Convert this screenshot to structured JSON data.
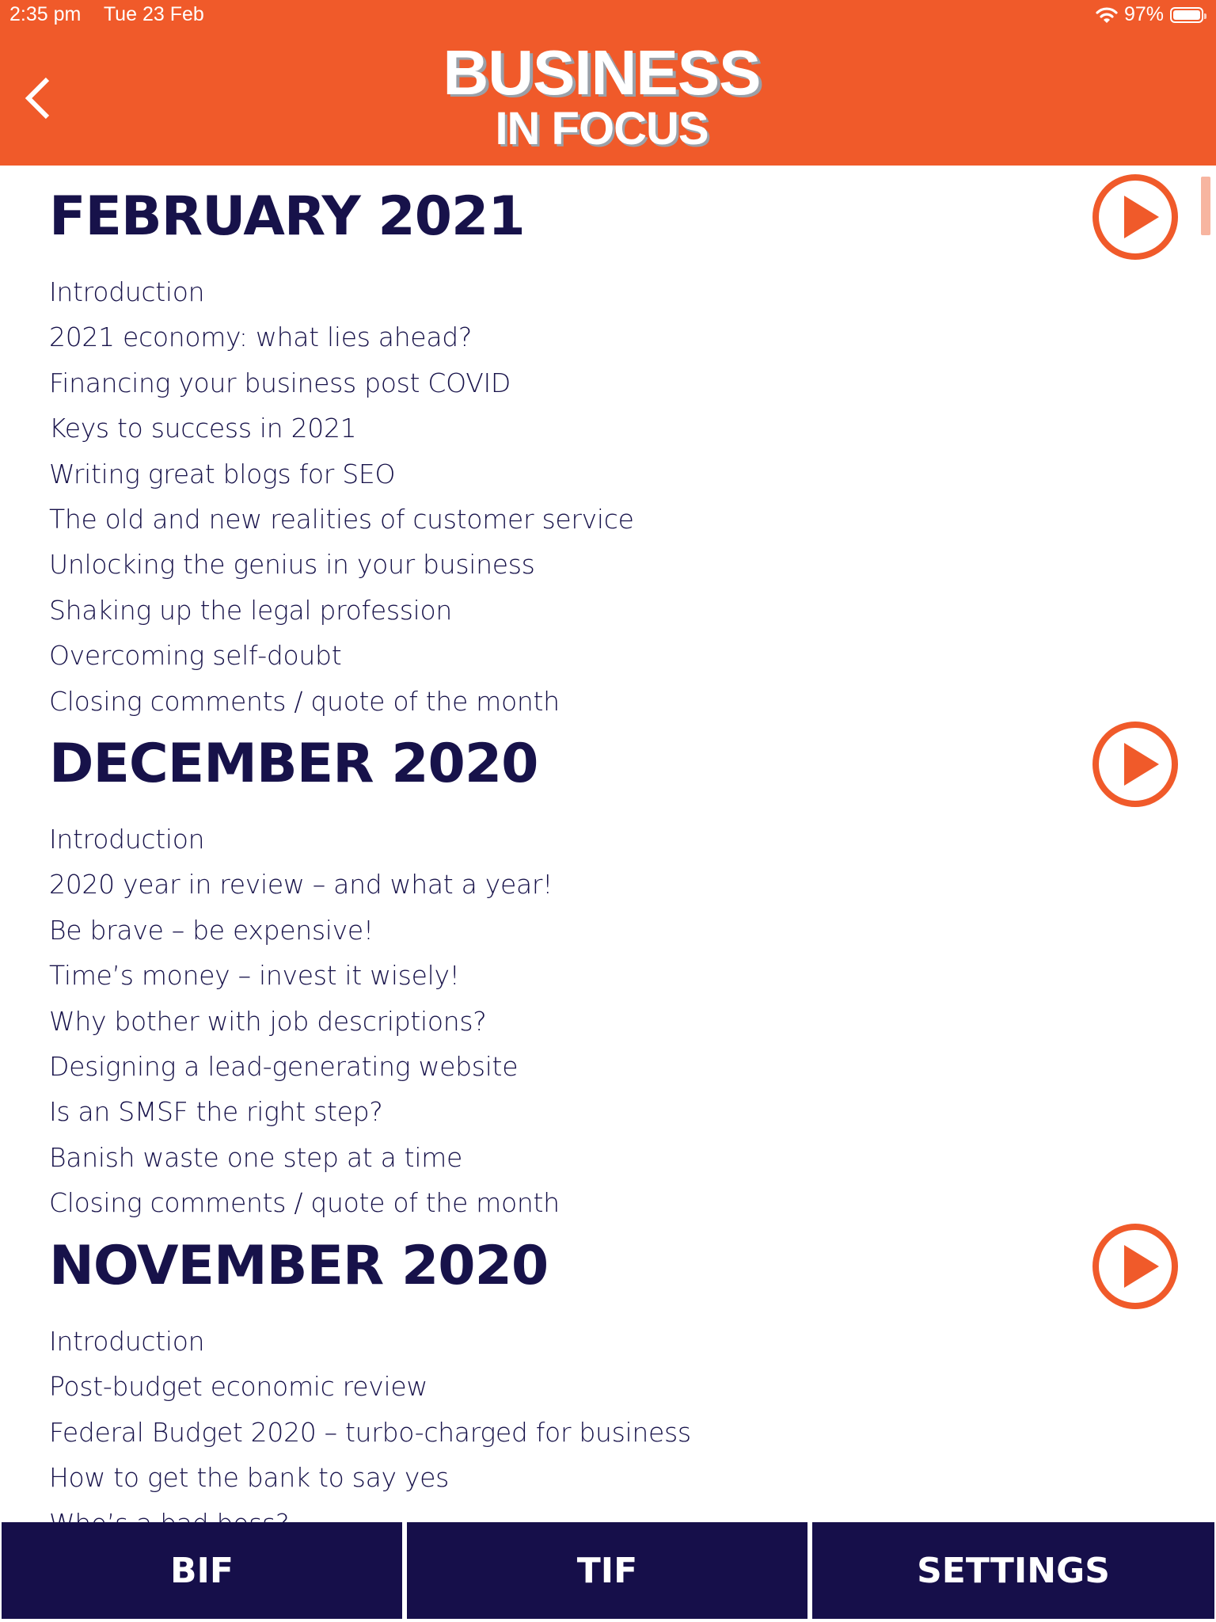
{
  "status_bar": {
    "time": "2:35 pm",
    "date": "Tue 23 Feb",
    "battery_percent": "97%"
  },
  "header": {
    "logo_line1": "BUSINESS",
    "logo_line2": "IN FOCUS",
    "accent_color": "#f05a2a"
  },
  "sections": [
    {
      "title": "FEBRUARY 2021",
      "items": [
        "Introduction",
        "2021 economy: what lies ahead?",
        "Financing your business post COVID",
        "Keys to success in 2021",
        "Writing great blogs for SEO",
        "The old and new realities of customer service",
        "Unlocking the genius in your business",
        "Shaking up the legal profession",
        "Overcoming self-doubt",
        "Closing comments / quote of the month"
      ]
    },
    {
      "title": "DECEMBER 2020",
      "items": [
        "Introduction",
        "2020 year in review – and what a year!",
        "Be brave – be expensive!",
        "Time’s money – invest it wisely!",
        "Why bother with job descriptions?",
        "Designing a lead-generating website",
        "Is an SMSF the right step?",
        "Banish waste one step at a time",
        "Closing comments / quote of the month"
      ]
    },
    {
      "title": "NOVEMBER 2020",
      "items": [
        "Introduction",
        "Post-budget economic review",
        "Federal Budget 2020 – turbo-charged for business",
        "How to get the bank to say yes",
        "Who’s a bad boss?"
      ]
    }
  ],
  "bottom_tabs": [
    {
      "label": "BIF"
    },
    {
      "label": "TIF"
    },
    {
      "label": "SETTINGS"
    }
  ],
  "colors": {
    "primary_navy": "#160f4a",
    "accent_orange": "#f05a2a"
  }
}
